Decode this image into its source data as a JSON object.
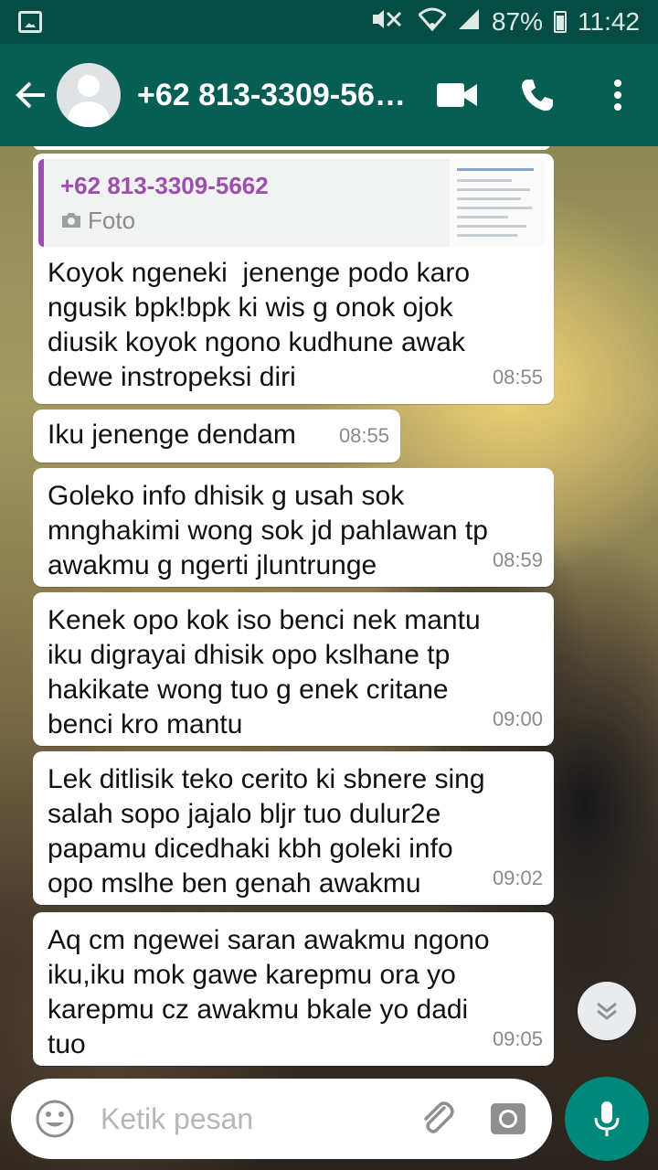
{
  "status_bar": {
    "battery": "87%",
    "time": "11:42"
  },
  "header": {
    "contact_name": "+62 813-3309-56…",
    "icons": [
      "back-arrow-icon",
      "avatar",
      "video-call-icon",
      "phone-icon",
      "more-vert-icon"
    ]
  },
  "messages": [
    {
      "quote": {
        "name": "+62 813-3309-5662",
        "type": "Foto"
      },
      "text": "Koyok ngeneki  jenenge podo karo\nngusik bpk!bpk ki wis g onok ojok\ndiusik koyok ngono kudhune awak\ndewe instropeksi diri",
      "time": "08:55"
    },
    {
      "text": "Iku jenenge dendam",
      "time": "08:55"
    },
    {
      "text": "Goleko info dhisik g usah sok\nmnghakimi wong sok jd pahlawan tp\nawakmu g ngerti jluntrunge",
      "time": "08:59"
    },
    {
      "text": "Kenek opo kok iso benci nek mantu\niku digrayai dhisik opo kslhane tp\nhakikate wong tuo g enek critane\nbenci kro mantu",
      "time": "09:00"
    },
    {
      "text": "Lek ditlisik teko cerito ki sbnere sing\nsalah sopo jajalo bljr tuo dulur2e\npapamu dicedhaki kbh goleki info\nopo mslhe ben genah awakmu",
      "time": "09:02"
    },
    {
      "text": "Aq cm ngewei saran awakmu ngono\niku,iku mok gawe karepmu ora yo\nkarepmu cz awakmu bkale yo dadi\ntuo",
      "time": "09:05"
    }
  ],
  "composer": {
    "placeholder": "Ketik pesan"
  },
  "colors": {
    "app_bar": "#075e54",
    "status_bar": "#054d44",
    "quote_accent": "#9c4fad",
    "mic_button": "#00897b"
  }
}
